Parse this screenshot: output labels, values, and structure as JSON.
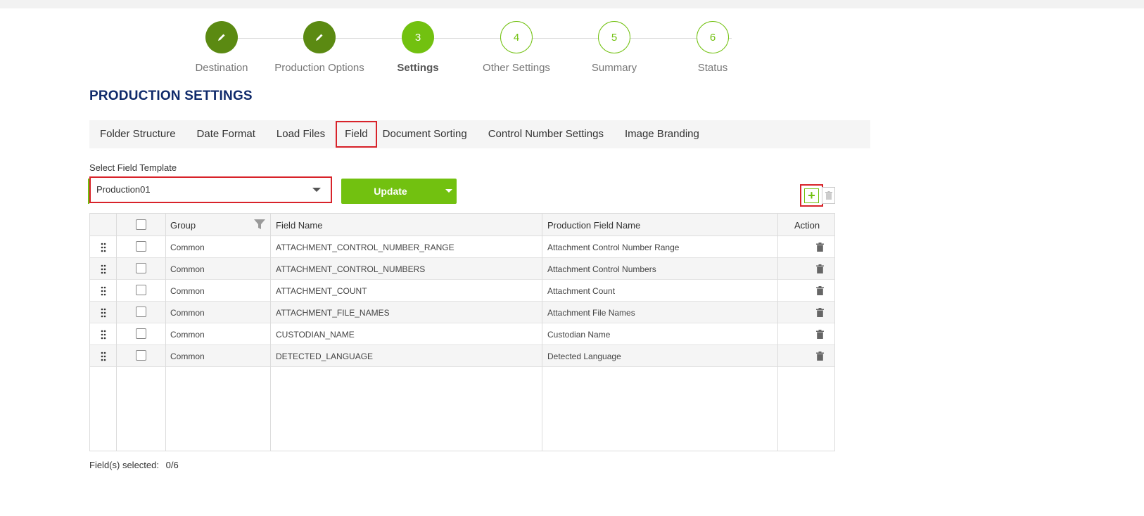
{
  "stepper": {
    "steps": [
      {
        "label": "Destination",
        "state": "done",
        "icon": "pencil-icon"
      },
      {
        "label": "Production Options",
        "state": "done",
        "icon": "pencil-icon"
      },
      {
        "label": "Settings",
        "state": "active",
        "number": "3"
      },
      {
        "label": "Other Settings",
        "state": "todo",
        "number": "4"
      },
      {
        "label": "Summary",
        "state": "todo",
        "number": "5"
      },
      {
        "label": "Status",
        "state": "todo",
        "number": "6"
      }
    ]
  },
  "page_title": "PRODUCTION SETTINGS",
  "tabs": [
    {
      "label": "Folder Structure"
    },
    {
      "label": "Date Format"
    },
    {
      "label": "Load Files"
    },
    {
      "label": "Field",
      "highlighted": true
    },
    {
      "label": "Document Sorting"
    },
    {
      "label": "Control Number Settings"
    },
    {
      "label": "Image Branding"
    }
  ],
  "template": {
    "label": "Select Field Template",
    "value": "Production01"
  },
  "toolbar": {
    "update_label": "Update",
    "add_icon": "plus-icon",
    "delete_icon": "trash-icon"
  },
  "grid": {
    "headers": {
      "group": "Group",
      "field_name": "Field Name",
      "production_field_name": "Production Field Name",
      "action": "Action"
    },
    "rows": [
      {
        "group": "Common",
        "field_name": "ATTACHMENT_CONTROL_NUMBER_RANGE",
        "production_field_name": "Attachment Control Number Range"
      },
      {
        "group": "Common",
        "field_name": "ATTACHMENT_CONTROL_NUMBERS",
        "production_field_name": "Attachment Control Numbers"
      },
      {
        "group": "Common",
        "field_name": "ATTACHMENT_COUNT",
        "production_field_name": "Attachment Count"
      },
      {
        "group": "Common",
        "field_name": "ATTACHMENT_FILE_NAMES",
        "production_field_name": "Attachment File Names"
      },
      {
        "group": "Common",
        "field_name": "CUSTODIAN_NAME",
        "production_field_name": "Custodian Name"
      },
      {
        "group": "Common",
        "field_name": "DETECTED_LANGUAGE",
        "production_field_name": "Detected Language"
      }
    ]
  },
  "footer": {
    "label": "Field(s) selected:",
    "value": "0/6"
  },
  "colors": {
    "accent_green": "#72c110",
    "done_green": "#5b8a12",
    "title_blue": "#0f2a6b",
    "highlight_red": "#d8232a"
  }
}
